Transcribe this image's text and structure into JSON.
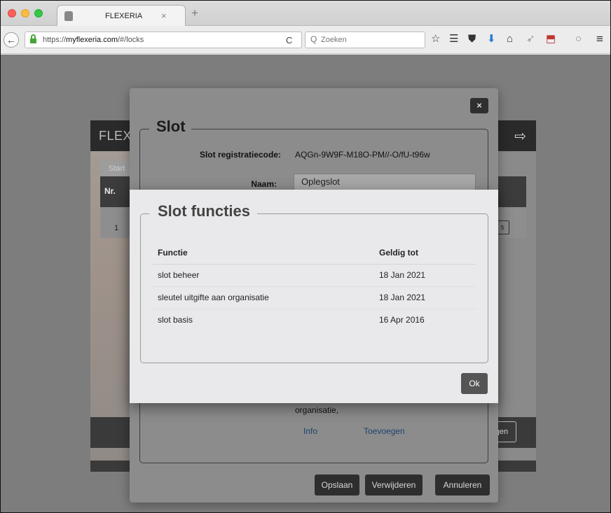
{
  "browser": {
    "tab_title": "FLEXERIA",
    "tab_close": "×",
    "new_tab": "+",
    "back": "←",
    "url_prefix": "https://",
    "url_host": "myflexeria.com",
    "url_path": "/#/locks",
    "reload": "C",
    "search_icon": "Q",
    "search_placeholder": "Zoeken",
    "toolbar_icons": [
      "☆",
      "☰",
      "⛊",
      "⬇",
      "⌂",
      "➶",
      "⬒",
      "○",
      "≡"
    ]
  },
  "app": {
    "logo": "FLEX",
    "start_tab": "Start",
    "table_header_nr": "Nr.",
    "row_nr": "1",
    "row_button": "s",
    "bottom_button": "gen"
  },
  "slot_modal": {
    "close": "×",
    "legend": "Slot",
    "registration_label": "Slot registratiecode:",
    "registration_value": "AQGn-9W9F-M18O-PM//-O/fU-t96w",
    "name_label": "Naam:",
    "name_value": "Oplegslot",
    "org_text": "organisatie,",
    "info_link": "Info",
    "add_link": "Toevoegen",
    "buttons": {
      "save": "Opslaan",
      "delete": "Verwijderen",
      "cancel": "Annuleren"
    }
  },
  "functions_modal": {
    "legend": "Slot functies",
    "columns": [
      "Functie",
      "Geldig tot"
    ],
    "rows": [
      {
        "function": "slot beheer",
        "valid_until": "18 Jan 2021"
      },
      {
        "function": "sleutel uitgifte aan organisatie",
        "valid_until": "18 Jan 2021"
      },
      {
        "function": "slot basis",
        "valid_until": "16 Apr 2016"
      }
    ],
    "ok": "Ok"
  }
}
